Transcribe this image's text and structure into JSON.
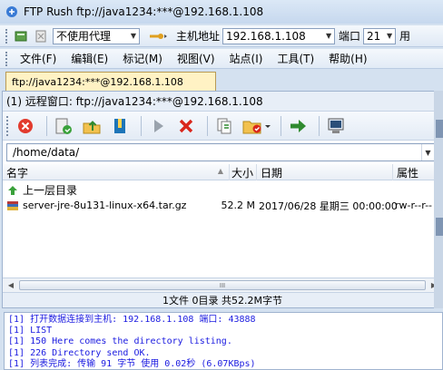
{
  "window": {
    "title": "FTP Rush   ftp://java1234:***@192.168.1.108"
  },
  "toolbar": {
    "proxy_value": "不使用代理",
    "host_label": "主机地址",
    "host_value": "192.168.1.108",
    "port_label": "端口",
    "port_value": "21",
    "user_label_partial": "用"
  },
  "menu": {
    "items": [
      "文件(F)",
      "编辑(E)",
      "标记(M)",
      "视图(V)",
      "站点(I)",
      "工具(T)",
      "帮助(H)"
    ]
  },
  "tabs": [
    {
      "label": "ftp://java1234:***@192.168.1.108"
    }
  ],
  "remote": {
    "header": "(1) 远程窗口:  ftp://java1234:***@192.168.1.108",
    "path": "/home/data/",
    "columns": [
      "名字",
      "大小",
      "日期",
      "属性"
    ],
    "parent_label": "上一层目录",
    "files": [
      {
        "name": "server-jre-8u131-linux-x64.tar.gz",
        "size": "52.2 M",
        "date": "2017/06/28 星期三 00:00:00",
        "attr": "rw-r--r--"
      }
    ],
    "scroll_thumb_glyph": "III",
    "status": "1文件 0目录 共52.2M字节"
  },
  "log": {
    "lines": [
      "[1] 打开数据连接到主机: 192.168.1.108 端口: 43888",
      "[1] LIST",
      "[1] 150 Here comes the directory listing.",
      "[1] 226 Directory send OK.",
      "[1] 列表完成: 传输 91 字节 使用 0.02秒 (6.07KBps)"
    ]
  },
  "colors": {
    "title_bar": "#c6d8ee",
    "tab_active": "#fff2c4",
    "log_text": "#1a1ae0",
    "accent": "#9fb3cf"
  },
  "icons": [
    "ftp-rush-app-icon",
    "connect-icon",
    "disconnect-icon",
    "proxy-icon",
    "close-icon",
    "refresh-icon",
    "upload-icon",
    "bookmark-icon",
    "play-icon",
    "stop-icon",
    "copy-icon",
    "folder-settings-icon",
    "transfer-icon",
    "terminal-icon",
    "up-folder-icon",
    "file-archive-icon"
  ]
}
